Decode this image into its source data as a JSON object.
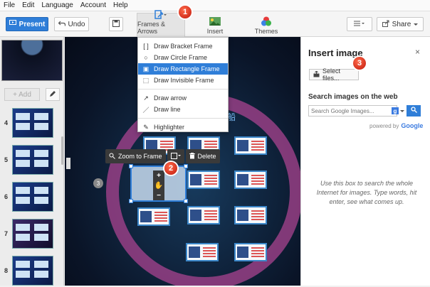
{
  "menubar": {
    "items": [
      "File",
      "Edit",
      "Language",
      "Account",
      "Help"
    ]
  },
  "toolbar": {
    "present_label": "Present",
    "undo_label": "Undo",
    "frames_label": "Frames & Arrows",
    "insert_label": "Insert",
    "themes_label": "Themes",
    "share_label": "Share"
  },
  "sidebar": {
    "add_label": "+ Add",
    "slides": [
      {
        "num": "4"
      },
      {
        "num": "5"
      },
      {
        "num": "6"
      },
      {
        "num": "7"
      },
      {
        "num": "8"
      }
    ]
  },
  "dropdown": {
    "items": [
      {
        "label": "Draw Bracket Frame",
        "icon": "bracket-frame-icon"
      },
      {
        "label": "Draw Circle Frame",
        "icon": "circle-frame-icon"
      },
      {
        "label": "Draw Rectangle Frame",
        "icon": "rectangle-frame-icon",
        "selected": true
      },
      {
        "label": "Draw Invisible Frame",
        "icon": "invisible-frame-icon"
      },
      {
        "label": "Draw arrow",
        "icon": "arrow-icon"
      },
      {
        "label": "Draw line",
        "icon": "line-icon"
      },
      {
        "label": "Highlighter",
        "icon": "highlighter-icon"
      }
    ]
  },
  "canvas": {
    "zoom_to_frame_label": "Zoom to Frame",
    "delete_label": "Delete",
    "path_number": "3",
    "chinese_text": "船"
  },
  "annotations": {
    "badge1": "1",
    "badge2": "2",
    "badge3": "3"
  },
  "right_panel": {
    "title": "Insert image",
    "close": "×",
    "select_files_label": "Select files...",
    "search_heading": "Search images on the web",
    "search_placeholder": "Search Google Images...",
    "powered_by": "powered by",
    "google": "Google",
    "help_text": "Use this box to search the whole Internet for images. Type words, hit enter, see what comes up."
  },
  "colors": {
    "accent": "#2f7ed8",
    "badge": "#d9261a"
  }
}
